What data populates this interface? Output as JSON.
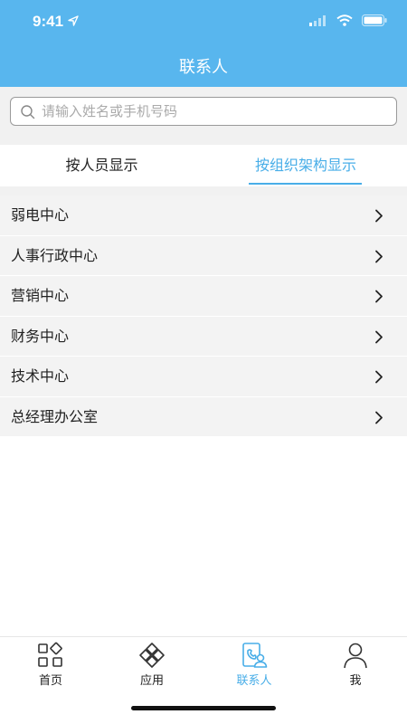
{
  "status_bar": {
    "time": "9:41"
  },
  "header": {
    "title": "联系人"
  },
  "search": {
    "placeholder": "请输入姓名或手机号码"
  },
  "tabs": [
    {
      "label": "按人员显示",
      "active": false
    },
    {
      "label": "按组织架构显示",
      "active": true
    }
  ],
  "departments": [
    {
      "label": "弱电中心"
    },
    {
      "label": "人事行政中心"
    },
    {
      "label": "营销中心"
    },
    {
      "label": "财务中心"
    },
    {
      "label": "技术中心"
    },
    {
      "label": "总经理办公室"
    }
  ],
  "bottom_nav": [
    {
      "label": "首页",
      "icon": "grid-icon",
      "active": false
    },
    {
      "label": "应用",
      "icon": "apps-icon",
      "active": false
    },
    {
      "label": "联系人",
      "icon": "contacts-icon",
      "active": true
    },
    {
      "label": "我",
      "icon": "person-icon",
      "active": false
    }
  ],
  "colors": {
    "header": "#58b6ee",
    "accent": "#49aee8",
    "list_bg": "#f3f3f3",
    "page_bg": "#f1f1f1"
  }
}
